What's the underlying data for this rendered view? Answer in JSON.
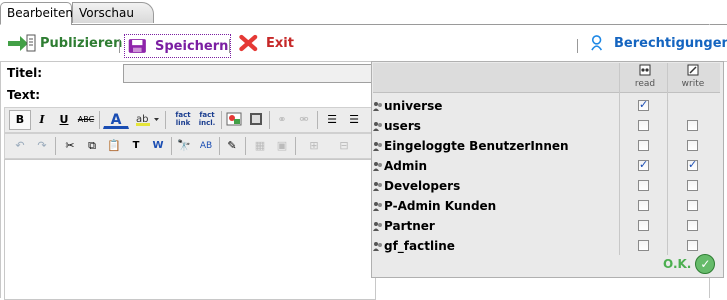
{
  "tabs": [
    {
      "label": "Bearbeiten",
      "active": true
    },
    {
      "label": "Vorschau",
      "active": false
    }
  ],
  "actions": {
    "publish": "Publizieren",
    "save": "Speichern",
    "exit": "Exit",
    "permissions": "Berechtigungen"
  },
  "fields": {
    "title_label": "Titel:",
    "text_label": "Text:"
  },
  "toolbar": {
    "bold": "B",
    "italic": "I",
    "underline": "U",
    "strike": "ABC",
    "fact_link": "fact link",
    "fact_incl": "fact incl."
  },
  "permissions_popup": {
    "read_header": "read",
    "write_header": "write",
    "ok_label": "O.K.",
    "groups": [
      {
        "name": "universe",
        "read": true,
        "write": null
      },
      {
        "name": "users",
        "read": false,
        "write": false
      },
      {
        "name": "Eingeloggte BenutzerInnen",
        "read": false,
        "write": false
      },
      {
        "name": "Admin",
        "read": true,
        "write": true
      },
      {
        "name": "Developers",
        "read": false,
        "write": false
      },
      {
        "name": "P-Admin Kunden",
        "read": false,
        "write": false
      },
      {
        "name": "Partner",
        "read": false,
        "write": false
      },
      {
        "name": "gf_factline",
        "read": false,
        "write": false
      }
    ]
  },
  "colors": {
    "publish": "#2e7d32",
    "save": "#7b1fa2",
    "exit": "#c62828",
    "permissions": "#1565c0",
    "ok": "#4caf50"
  }
}
